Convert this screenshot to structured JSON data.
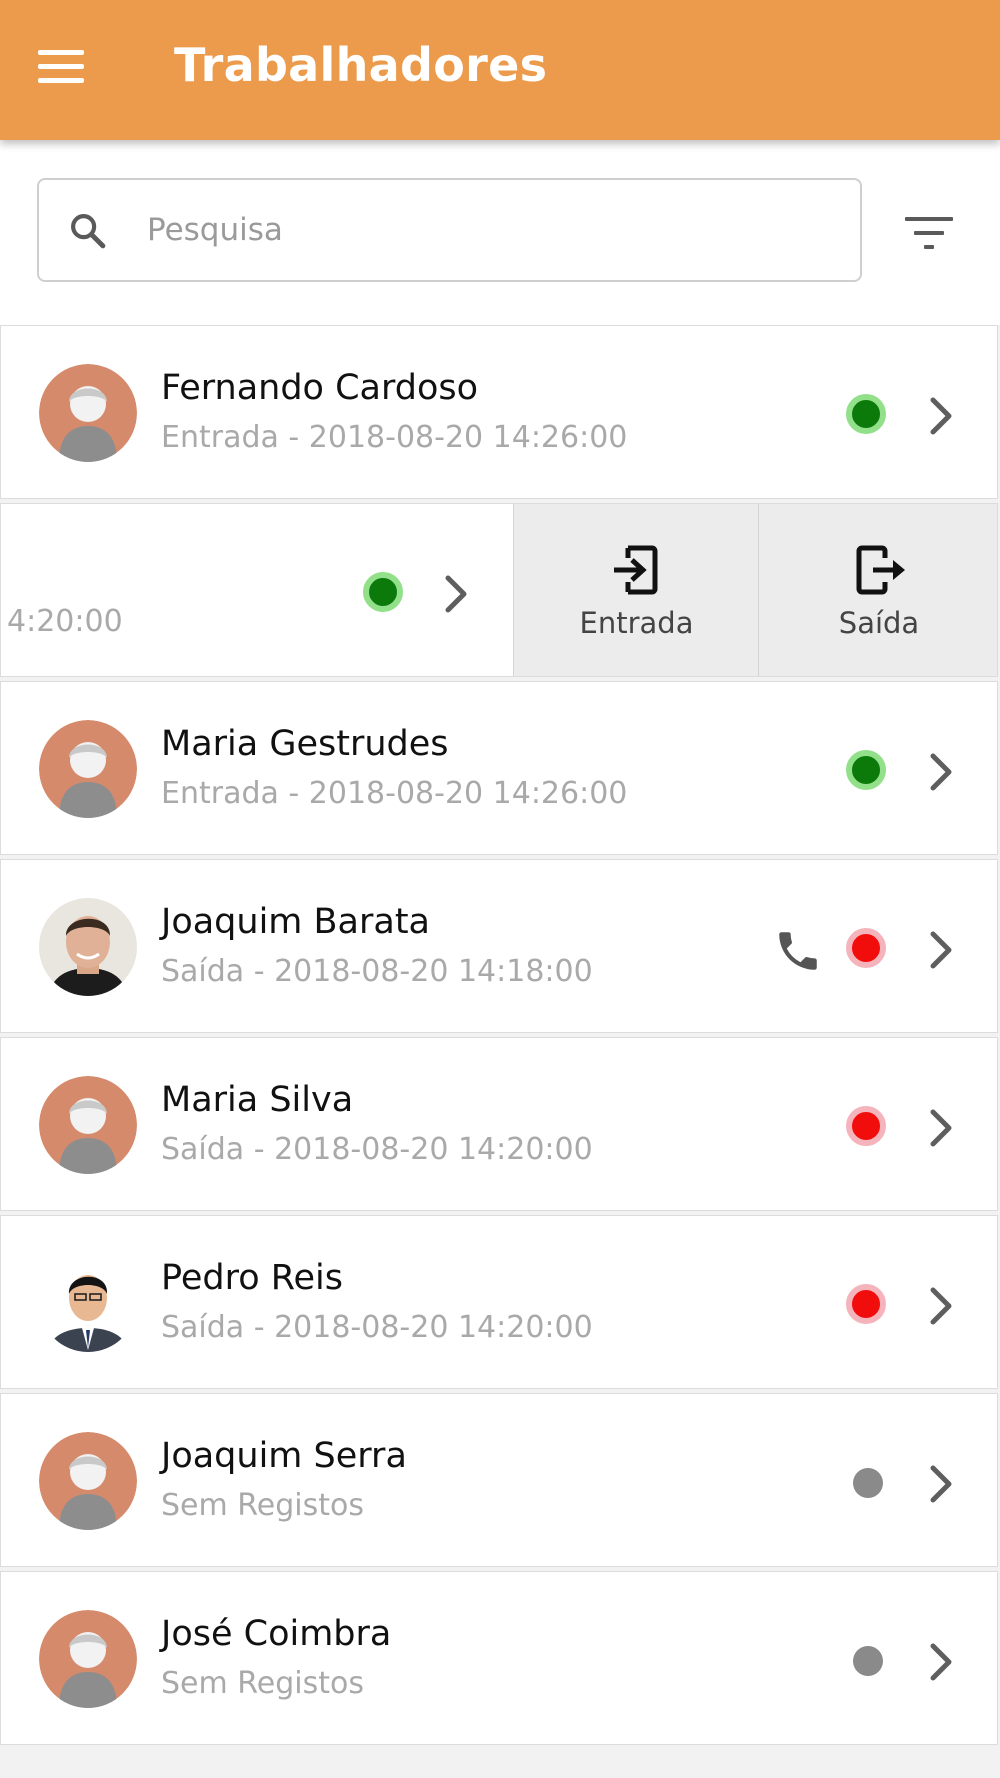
{
  "header": {
    "title": "Trabalhadores",
    "background_color": "#ec9b4d",
    "menu_icon": "hamburger-menu-icon"
  },
  "search": {
    "placeholder": "Pesquisa",
    "value": "",
    "icon": "search-icon",
    "filter_icon": "filter-icon"
  },
  "status_colors": {
    "in": "#0b7a0b",
    "out": "#f20d0d",
    "none": "#8a8a8a"
  },
  "workers": [
    {
      "name": "Fernando Cardoso",
      "subtitle": "Entrada - 2018-08-20 14:26:00",
      "status": "in"
    },
    {
      "name": "",
      "subtitle": "4:20:00",
      "status": "in",
      "swiped": true,
      "actions": [
        {
          "label": "Entrada",
          "icon": "login-icon"
        },
        {
          "label": "Saída",
          "icon": "logout-icon"
        }
      ]
    },
    {
      "name": "Maria Gestrudes",
      "subtitle": "Entrada - 2018-08-20 14:26:00",
      "status": "in"
    },
    {
      "name": "Joaquim Barata",
      "subtitle": "Saída - 2018-08-20 14:18:00",
      "status": "out",
      "phone": true,
      "photo": true
    },
    {
      "name": "Maria Silva",
      "subtitle": "Saída - 2018-08-20 14:20:00",
      "status": "out"
    },
    {
      "name": "Pedro Reis",
      "subtitle": "Saída - 2018-08-20 14:20:00",
      "status": "out",
      "photo": true
    },
    {
      "name": "Joaquim Serra",
      "subtitle": "Sem Registos",
      "status": "none"
    },
    {
      "name": "José Coimbra",
      "subtitle": "Sem Registos",
      "status": "none"
    }
  ]
}
